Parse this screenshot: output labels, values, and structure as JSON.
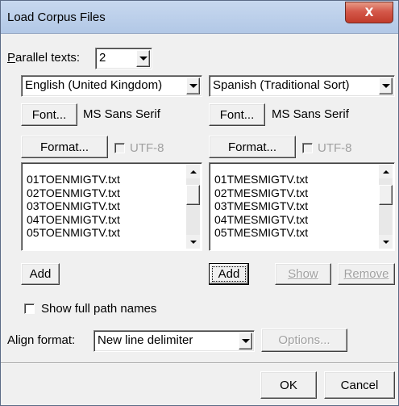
{
  "window": {
    "title": "Load Corpus Files",
    "close_label": "X"
  },
  "parallel": {
    "label_prefix": "P",
    "label_rest": "arallel texts:",
    "value": "2"
  },
  "left": {
    "language": "English (United Kingdom)",
    "font_button": "Font...",
    "font_name": "MS Sans Serif",
    "format_button": "Format...",
    "utf8_label": "UTF-8",
    "files": [
      "01TOENMIGTV.txt",
      "02TOENMIGTV.txt",
      "03TOENMIGTV.txt",
      "04TOENMIGTV.txt",
      "05TOENMIGTV.txt"
    ],
    "add_button": "Add"
  },
  "right": {
    "language": "Spanish (Traditional Sort)",
    "font_button": "Font...",
    "font_name": "MS Sans Serif",
    "format_button": "Format...",
    "utf8_label": "UTF-8",
    "files": [
      "01TMESMIGTV.txt",
      "02TMESMIGTV.txt",
      "03TMESMIGTV.txt",
      "04TMESMIGTV.txt",
      "05TMESMIGTV.txt"
    ],
    "add_button": "Add",
    "show_button": "Show",
    "remove_button": "Remove"
  },
  "options": {
    "show_full_path_label": "Show full path names",
    "align_label": "Align format:",
    "align_value": "New line delimiter",
    "options_button": "Options..."
  },
  "footer": {
    "ok": "OK",
    "cancel": "Cancel"
  }
}
